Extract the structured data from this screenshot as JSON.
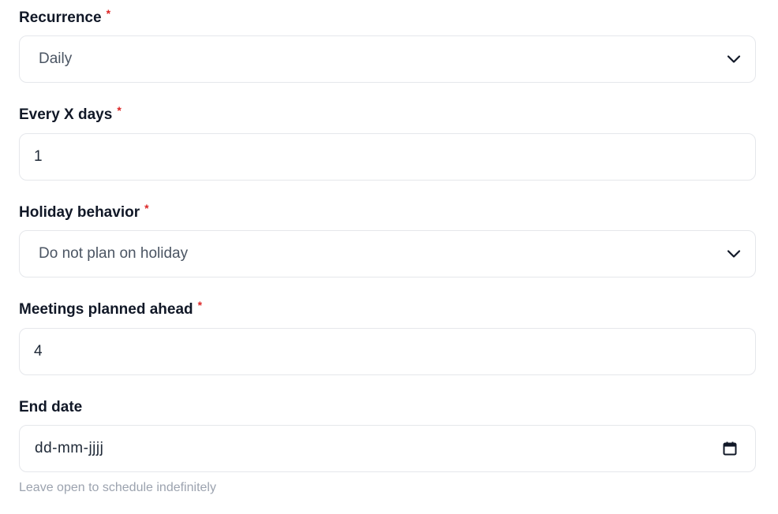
{
  "recurrence": {
    "label": "Recurrence",
    "required_mark": "*",
    "selected": "Daily",
    "icon": "chevron-down-icon"
  },
  "every_x_days": {
    "label": "Every X days",
    "required_mark": "*",
    "value": "1"
  },
  "holiday_behavior": {
    "label": "Holiday behavior",
    "required_mark": "*",
    "selected": "Do not plan on holiday",
    "icon": "chevron-down-icon"
  },
  "meetings_planned_ahead": {
    "label": "Meetings planned ahead",
    "required_mark": "*",
    "value": "4"
  },
  "end_date": {
    "label": "End date",
    "placeholder": "dd-mm-jjjj",
    "icon": "calendar-icon",
    "help_text": "Leave open to schedule indefinitely"
  },
  "colors": {
    "required": "#dc2626",
    "border": "#e5e7eb",
    "help_text": "#9ca3af"
  }
}
